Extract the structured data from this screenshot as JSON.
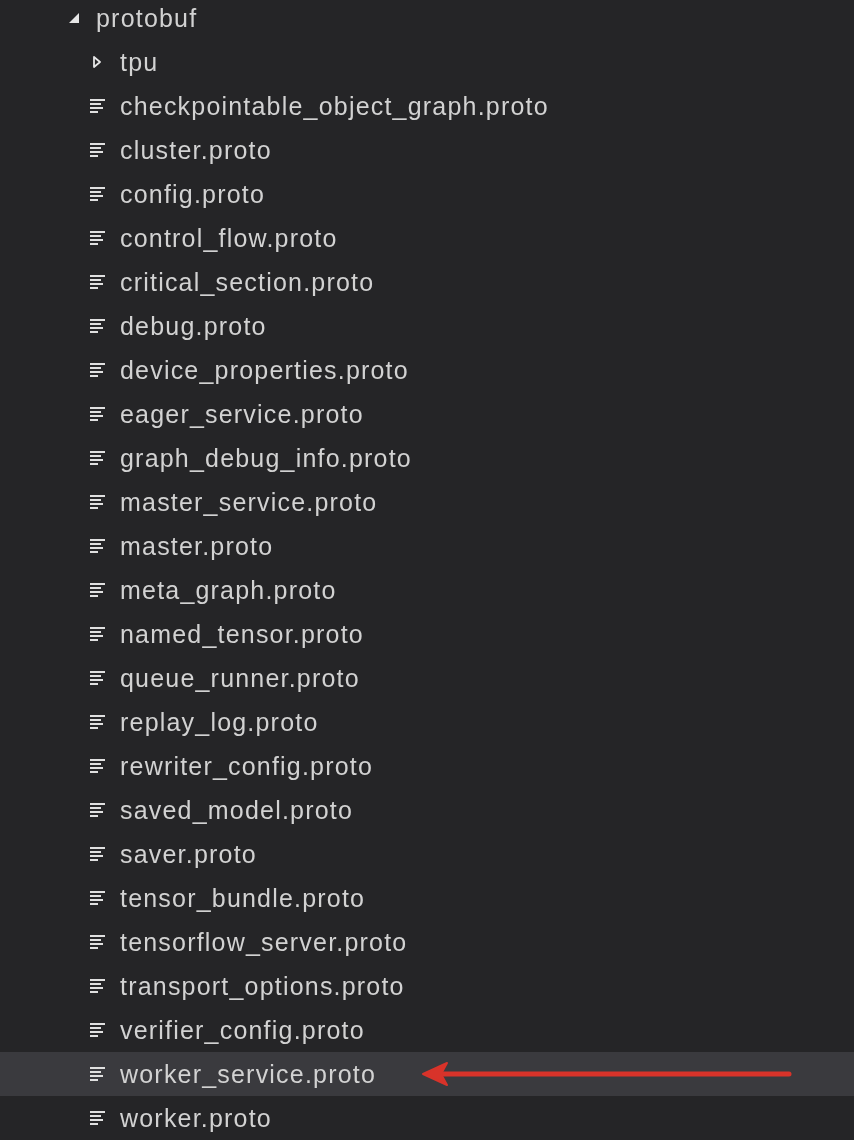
{
  "tree": {
    "kind": "folder",
    "name": "protobuf",
    "expanded": true,
    "selected": false,
    "children": [
      {
        "kind": "folder",
        "name": "tpu",
        "expanded": false,
        "selected": false
      },
      {
        "kind": "file",
        "name": "checkpointable_object_graph.proto",
        "selected": false
      },
      {
        "kind": "file",
        "name": "cluster.proto",
        "selected": false
      },
      {
        "kind": "file",
        "name": "config.proto",
        "selected": false
      },
      {
        "kind": "file",
        "name": "control_flow.proto",
        "selected": false
      },
      {
        "kind": "file",
        "name": "critical_section.proto",
        "selected": false
      },
      {
        "kind": "file",
        "name": "debug.proto",
        "selected": false
      },
      {
        "kind": "file",
        "name": "device_properties.proto",
        "selected": false
      },
      {
        "kind": "file",
        "name": "eager_service.proto",
        "selected": false
      },
      {
        "kind": "file",
        "name": "graph_debug_info.proto",
        "selected": false
      },
      {
        "kind": "file",
        "name": "master_service.proto",
        "selected": false
      },
      {
        "kind": "file",
        "name": "master.proto",
        "selected": false
      },
      {
        "kind": "file",
        "name": "meta_graph.proto",
        "selected": false
      },
      {
        "kind": "file",
        "name": "named_tensor.proto",
        "selected": false
      },
      {
        "kind": "file",
        "name": "queue_runner.proto",
        "selected": false
      },
      {
        "kind": "file",
        "name": "replay_log.proto",
        "selected": false
      },
      {
        "kind": "file",
        "name": "rewriter_config.proto",
        "selected": false
      },
      {
        "kind": "file",
        "name": "saved_model.proto",
        "selected": false
      },
      {
        "kind": "file",
        "name": "saver.proto",
        "selected": false
      },
      {
        "kind": "file",
        "name": "tensor_bundle.proto",
        "selected": false
      },
      {
        "kind": "file",
        "name": "tensorflow_server.proto",
        "selected": false
      },
      {
        "kind": "file",
        "name": "transport_options.proto",
        "selected": false
      },
      {
        "kind": "file",
        "name": "verifier_config.proto",
        "selected": false
      },
      {
        "kind": "file",
        "name": "worker_service.proto",
        "selected": true
      },
      {
        "kind": "file",
        "name": "worker.proto",
        "selected": false
      }
    ]
  }
}
